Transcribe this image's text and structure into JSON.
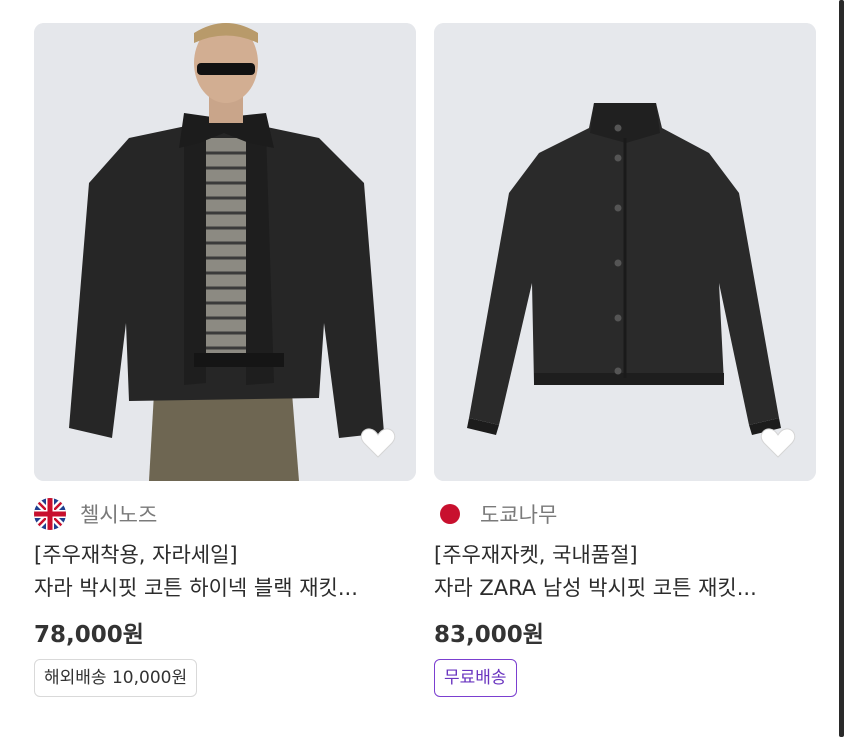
{
  "products": [
    {
      "seller": "첼시노즈",
      "country_flag": "uk-flag-icon",
      "promo": "[주우재착용, 자라세일]",
      "title": "자라 박시핏 코튼 하이넥 블랙 재킷...",
      "price": "78,000원",
      "shipping": "해외배송 10,000원",
      "image": "model-wearing-black-jacket"
    },
    {
      "seller": "도쿄나무",
      "country_flag": "japan-flag-icon",
      "promo": "[주우재자켓, 국내품절]",
      "title": "자라 ZARA 남성 박시핏 코튼 재킷...",
      "price": "83,000원",
      "shipping": "무료배송",
      "image": "black-jacket-product-shot"
    }
  ],
  "colors": {
    "free_shipping_accent": "#7b3fd0",
    "image_background": "#e6e8ec",
    "heart": "#ffffff"
  }
}
